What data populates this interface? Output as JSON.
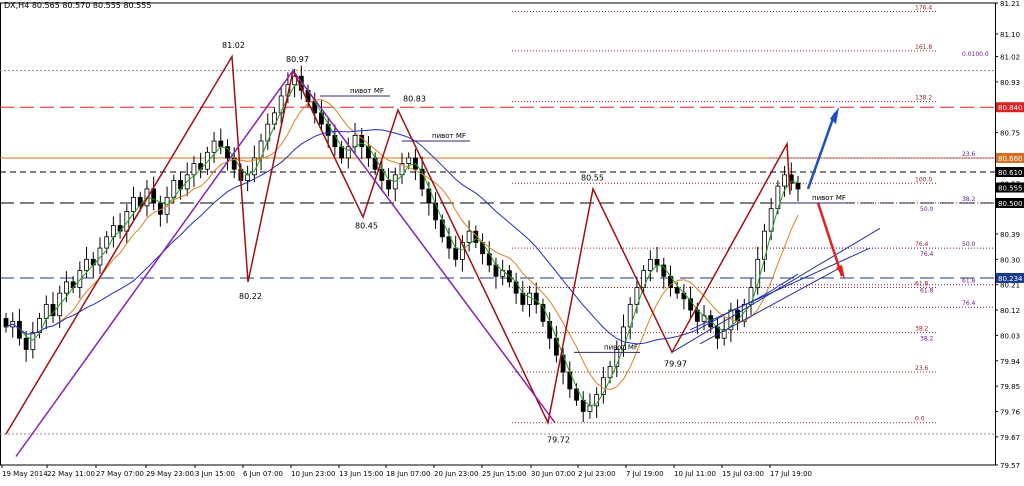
{
  "chart_data": {
    "type": "candlestick",
    "title": "DX,H4  80.565 80.570 80.555 80.555",
    "instrument": "DX",
    "timeframe": "H4",
    "ohlc_header": {
      "open": 80.565,
      "high": 80.57,
      "low": 80.555,
      "close": 80.555
    },
    "ylim": [
      79.57,
      81.21
    ],
    "y_ticks": [
      81.21,
      81.1,
      81.02,
      80.93,
      80.84,
      80.75,
      80.66,
      80.57,
      80.39,
      80.3,
      80.21,
      80.12,
      80.03,
      79.94,
      79.85,
      79.76,
      79.67,
      79.57
    ],
    "x_ticks": [
      "19 May 2014",
      "22 May 11:00",
      "27 May 07:00",
      "29 May 23:00",
      "3 Jun 15:00",
      "6 Jun 07:00",
      "10 Jun 23:00",
      "13 Jun 15:00",
      "18 Jun 07:00",
      "20 Jun 23:00",
      "25 Jun 15:00",
      "30 Jun 07:00",
      "2 Jul 23:00",
      "7 Jul 19:00",
      "10 Jul 11:00",
      "15 Jul 03:00",
      "17 Jul 19:00"
    ],
    "price_tags": [
      {
        "value": "80.840",
        "color": "#e02020"
      },
      {
        "value": "80.660",
        "color": "#d07020"
      },
      {
        "value": "80.610",
        "color": "#000000"
      },
      {
        "value": "80.555",
        "color": "#000000"
      },
      {
        "value": "80.500",
        "color": "#000000"
      },
      {
        "value": "80.234",
        "color": "#1a3a8a"
      }
    ],
    "swing_labels": [
      "81.02",
      "80.97",
      "80.83",
      "80.45",
      "80.22",
      "80.55",
      "79.97",
      "79.72"
    ],
    "pivot_labels": [
      "пивот MF",
      "пивот MF",
      "пивот MF",
      "пивот MF"
    ],
    "fib_main": {
      "levels": [
        176.4,
        161.8,
        138.2,
        100.0,
        76.4,
        61.8,
        38.2,
        23.6,
        0.0
      ]
    },
    "fib_100_label": "0.0100.0",
    "fib_secondary_a": [
      "23.6",
      "38.2",
      "50.0",
      "61.8",
      "76.4"
    ],
    "fib_secondary_b": [
      "76.4",
      "50.0",
      "38.2",
      "61.8"
    ],
    "closes": [
      80.06,
      80.08,
      80.02,
      79.98,
      80.04,
      80.09,
      80.14,
      80.1,
      80.18,
      80.22,
      80.2,
      80.26,
      80.3,
      80.28,
      80.34,
      80.38,
      80.42,
      80.4,
      80.47,
      80.52,
      80.49,
      80.55,
      80.5,
      80.46,
      80.52,
      80.58,
      80.55,
      80.6,
      80.64,
      80.62,
      80.68,
      80.72,
      80.7,
      80.66,
      80.62,
      80.58,
      80.6,
      80.66,
      80.72,
      80.78,
      80.82,
      80.88,
      80.92,
      80.95,
      80.9,
      80.86,
      80.82,
      80.78,
      80.74,
      80.7,
      80.66,
      80.7,
      80.74,
      80.7,
      80.66,
      80.62,
      80.58,
      80.55,
      80.6,
      80.64,
      80.66,
      80.62,
      80.55,
      80.5,
      80.44,
      80.38,
      80.34,
      80.3,
      80.36,
      80.4,
      80.36,
      80.32,
      80.28,
      80.24,
      80.26,
      80.22,
      80.18,
      80.14,
      80.18,
      80.14,
      80.08,
      80.02,
      79.96,
      79.9,
      79.84,
      79.8,
      79.76,
      79.78,
      79.82,
      79.88,
      79.92,
      79.98,
      80.06,
      80.14,
      80.2,
      80.26,
      80.3,
      80.28,
      80.24,
      80.2,
      80.18,
      80.16,
      80.12,
      80.08,
      80.1,
      80.06,
      80.02,
      80.05,
      80.12,
      80.08,
      80.14,
      80.2,
      80.3,
      80.4,
      80.48,
      80.56,
      80.6,
      80.57,
      80.55
    ]
  }
}
